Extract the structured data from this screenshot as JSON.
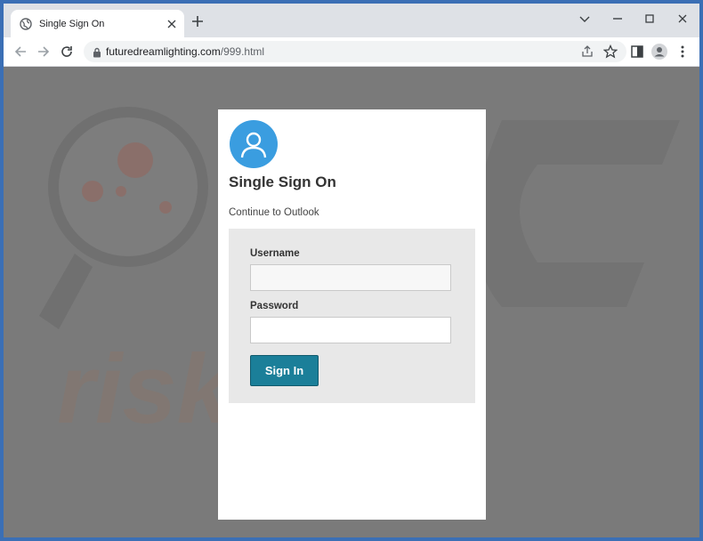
{
  "browser": {
    "tab_title": "Single Sign On",
    "url_host": "futuredreamlighting.com",
    "url_path": "/999.html"
  },
  "page": {
    "title": "Single Sign On",
    "subtitle": "Continue to Outlook",
    "username_label": "Username",
    "username_value": "",
    "password_label": "Password",
    "password_value": "",
    "signin_label": "Sign In"
  },
  "colors": {
    "accent": "#1b7f99",
    "avatar": "#3a9de0",
    "backdrop": "#7a7a7a"
  },
  "icons": [
    "globe-icon",
    "close-icon",
    "plus-icon",
    "minimize-icon",
    "maximize-icon",
    "window-close-icon",
    "back-icon",
    "forward-icon",
    "reload-icon",
    "lock-icon",
    "share-icon",
    "star-icon",
    "sidebar-icon",
    "profile-icon",
    "menu-icon",
    "user-icon"
  ]
}
